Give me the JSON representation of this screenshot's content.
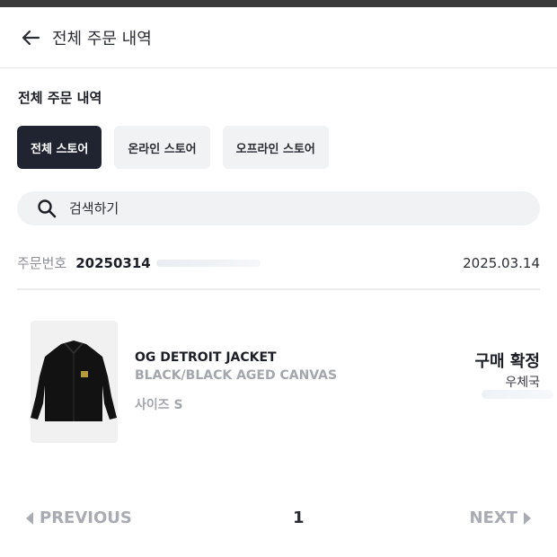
{
  "header": {
    "title": "전체 주문 내역"
  },
  "section": {
    "title": "전체 주문 내역"
  },
  "filters": [
    {
      "label": "전체 스토어",
      "active": true
    },
    {
      "label": "온라인 스토어",
      "active": false
    },
    {
      "label": "오프라인 스토어",
      "active": false
    }
  ],
  "search": {
    "placeholder": "검색하기",
    "value": ""
  },
  "order": {
    "number_label": "주문번호",
    "number": "20250314",
    "date": "2025.03.14",
    "items": [
      {
        "name": "OG DETROIT JACKET",
        "color": "BLACK/BLACK AGED CANVAS",
        "size": "사이즈 S",
        "status": "구매 확정",
        "delivery": "우체국"
      }
    ]
  },
  "pagination": {
    "prev_label": "PREVIOUS",
    "current_page": "1",
    "next_label": "NEXT"
  },
  "colors": {
    "primary_dark": "#1f2430",
    "chip_bg": "#f1f2f4",
    "muted_text": "#a3a6ac"
  },
  "icons": {
    "back": "arrow-left-icon",
    "search": "search-icon",
    "prev": "caret-left-icon",
    "next": "caret-right-icon"
  }
}
